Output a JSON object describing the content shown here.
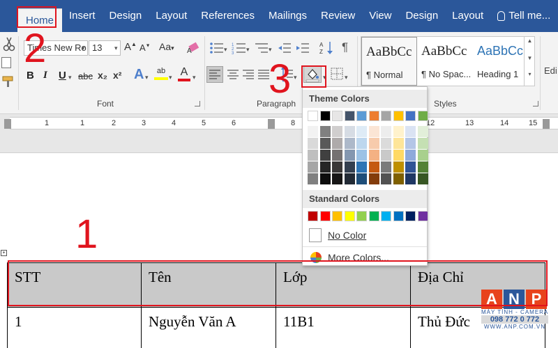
{
  "tabs": [
    {
      "label": "Home"
    },
    {
      "label": "Insert"
    },
    {
      "label": "Design"
    },
    {
      "label": "Layout"
    },
    {
      "label": "References"
    },
    {
      "label": "Mailings"
    },
    {
      "label": "Review"
    },
    {
      "label": "View"
    },
    {
      "label": "Design"
    },
    {
      "label": "Layout"
    },
    {
      "label": "Tell me..."
    }
  ],
  "ribbon": {
    "font_name": "Times New Ro",
    "font_size": "13",
    "bold": "B",
    "italic": "I",
    "underline": "U",
    "strike": "abc",
    "subscript": "x₂",
    "superscript": "x²",
    "change_case": "Aa",
    "font_group": "Font",
    "paragraph_group": "Paragraph",
    "styles_group": "Styles",
    "editing_partial": "Edi",
    "styles": [
      {
        "sample": "AaBbCc",
        "name": "¶ Normal"
      },
      {
        "sample": "AaBbCc",
        "name": "¶ No Spac..."
      },
      {
        "sample": "AaBbCc",
        "name": "Heading 1"
      }
    ]
  },
  "ruler": {
    "numbers": [
      "1",
      "1",
      "2",
      "3",
      "4",
      "5",
      "6",
      "7",
      "8",
      "12",
      "13",
      "14",
      "15"
    ]
  },
  "annotations": {
    "one": "1",
    "two": "2",
    "three": "3"
  },
  "shading_dropdown": {
    "theme_title": "Theme Colors",
    "standard_title": "Standard Colors",
    "no_color": "No Color",
    "more_colors": "More Colors...",
    "theme_top": [
      "#ffffff",
      "#000000",
      "#e7e6e6",
      "#44546a",
      "#5b9bd5",
      "#ed7d31",
      "#a5a5a5",
      "#ffc000",
      "#4472c4",
      "#70ad47"
    ],
    "theme_shades": [
      [
        "#f2f2f2",
        "#d9d9d9",
        "#bfbfbf",
        "#a6a6a6",
        "#808080"
      ],
      [
        "#808080",
        "#595959",
        "#404040",
        "#262626",
        "#0d0d0d"
      ],
      [
        "#d0cece",
        "#aeaaaa",
        "#757171",
        "#3a3838",
        "#171616"
      ],
      [
        "#d6dce4",
        "#adb9ca",
        "#8497b0",
        "#333f4f",
        "#222a35"
      ],
      [
        "#deebf6",
        "#bdd7ee",
        "#9cc2e5",
        "#2e75b5",
        "#1f4e79"
      ],
      [
        "#fbe5d5",
        "#f7cbac",
        "#f4b183",
        "#c55a11",
        "#833c0b"
      ],
      [
        "#ededed",
        "#dbdbdb",
        "#c9c9c9",
        "#7b7b7b",
        "#525252"
      ],
      [
        "#fff2cc",
        "#fee599",
        "#ffd965",
        "#bf9000",
        "#7f6000"
      ],
      [
        "#dae3f3",
        "#b4c6e7",
        "#8eaadb",
        "#2f5496",
        "#1f3864"
      ],
      [
        "#e2efd9",
        "#c5e0b3",
        "#a8d08d",
        "#538135",
        "#375623"
      ]
    ],
    "standard": [
      "#c00000",
      "#ff0000",
      "#ffc000",
      "#ffff00",
      "#92d050",
      "#00b050",
      "#00b0f0",
      "#0070c0",
      "#002060",
      "#7030a0"
    ]
  },
  "table": {
    "headers": [
      "STT",
      "Tên",
      "Lớp",
      "Địa Chỉ"
    ],
    "rows": [
      [
        "1",
        "Nguyễn Văn A",
        "11B1",
        "Thủ Đức"
      ]
    ]
  },
  "watermark": {
    "letters": [
      "A",
      "N",
      "P"
    ],
    "tagline": "MÁY TÍNH - CAMERA",
    "phone": "098 772 0 772",
    "site": "WWW.ANP.COM.VN",
    "colors": [
      "#e8431c",
      "#2b579a",
      "#e8431c"
    ]
  }
}
